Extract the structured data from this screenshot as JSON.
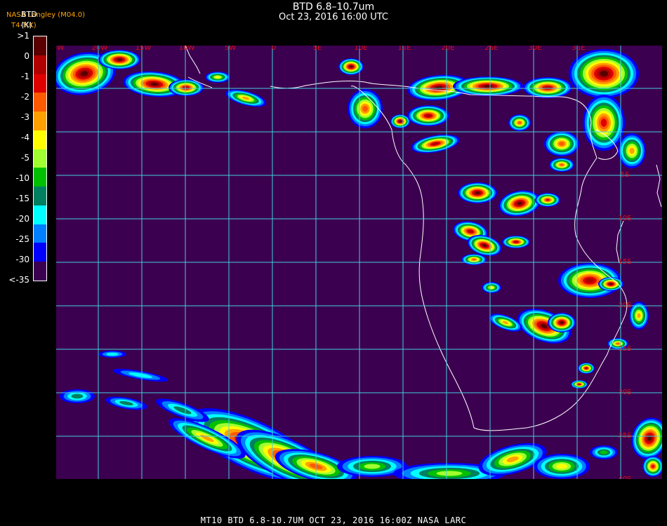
{
  "header": {
    "title": "BTD 6.8–10.7um",
    "subtitle": "Oct 23, 2016 16:00 UTC",
    "credit_line1": "NASA Langley (M04.0)",
    "credit_line2": "T4-T(K)",
    "overlay_line1": "BTD",
    "overlay_line2": "(K)"
  },
  "legend": {
    "labels": [
      ">1",
      "0",
      "-1",
      "-2",
      "-3",
      "-4",
      "-5",
      "-10",
      "-15",
      "-20",
      "-25",
      "-30",
      "<-35"
    ],
    "colors": [
      "#5a0000",
      "#b00000",
      "#e00000",
      "#ff5a00",
      "#ffa000",
      "#ffff00",
      "#a0ff30",
      "#00c000",
      "#008060",
      "#00ffff",
      "#0080ff",
      "#0000ff",
      "#3c0050"
    ]
  },
  "map": {
    "lon_labels": [
      "25W",
      "20W",
      "15W",
      "10W",
      "5W",
      "0",
      "5E",
      "10E",
      "15E",
      "20E",
      "25E",
      "30E",
      "35E"
    ],
    "lat_labels": [
      "5S",
      "10S",
      "15S",
      "20S",
      "25S",
      "30S",
      "35S",
      "40S"
    ],
    "grid_color": "#40d0e0",
    "label_color": "#e01010",
    "background_color": "#3c0050"
  },
  "footer": {
    "text": "MT10  BTD 6.8-10.7UM   OCT 23, 2016 16:00Z  NASA LARC"
  }
}
